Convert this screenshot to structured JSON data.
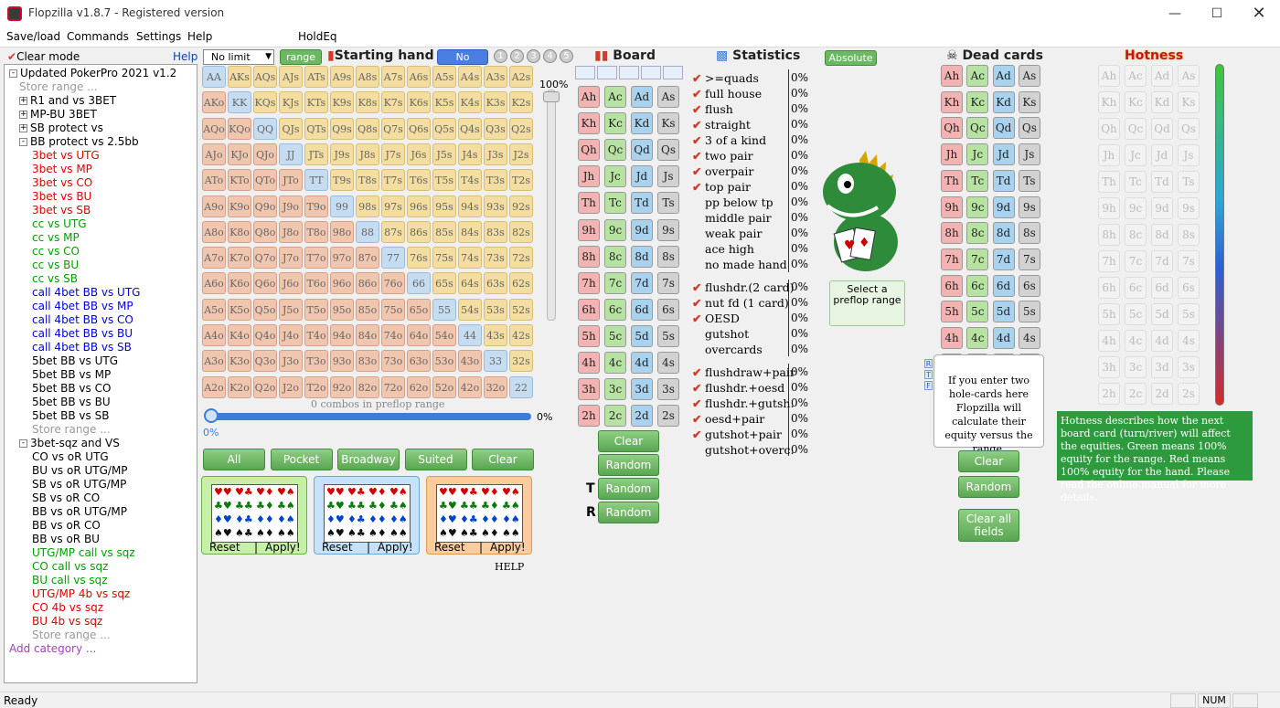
{
  "title": "Flopzilla v1.8.7 - Registered version",
  "menu": [
    "Save/load",
    "Commands",
    "Settings",
    "Help",
    "HoldEq"
  ],
  "left": {
    "clear_mode": "Clear mode",
    "help": "Help",
    "tree": [
      {
        "t": "Updated PokerPro 2021 v1.2",
        "lvl": 0,
        "pm": "-",
        "c": "#000"
      },
      {
        "t": "Store range ...",
        "lvl": 1,
        "c": "#999"
      },
      {
        "t": "R1 and vs 3BET",
        "lvl": 1,
        "pm": "+",
        "c": "#000"
      },
      {
        "t": "MP-BU 3BET",
        "lvl": 1,
        "pm": "+",
        "c": "#000"
      },
      {
        "t": "SB protect vs",
        "lvl": 1,
        "pm": "+",
        "c": "#000"
      },
      {
        "t": "BB protect vs 2.5bb",
        "lvl": 1,
        "pm": "-",
        "c": "#000"
      },
      {
        "t": "3bet vs UTG",
        "lvl": 2,
        "c": "#e00000"
      },
      {
        "t": "3bet vs MP",
        "lvl": 2,
        "c": "#e00000"
      },
      {
        "t": "3bet vs CO",
        "lvl": 2,
        "c": "#e00000"
      },
      {
        "t": "3bet vs BU",
        "lvl": 2,
        "c": "#e00000"
      },
      {
        "t": "3bet vs SB",
        "lvl": 2,
        "c": "#e00000"
      },
      {
        "t": "cc vs UTG",
        "lvl": 2,
        "c": "#00a000"
      },
      {
        "t": "cc vs MP",
        "lvl": 2,
        "c": "#00a000"
      },
      {
        "t": "cc vs CO",
        "lvl": 2,
        "c": "#00a000"
      },
      {
        "t": "cc vs BU",
        "lvl": 2,
        "c": "#00a000"
      },
      {
        "t": "cc vs SB",
        "lvl": 2,
        "c": "#00a000"
      },
      {
        "t": "call 4bet BB vs UTG",
        "lvl": 2,
        "c": "#0000e0"
      },
      {
        "t": "call 4bet BB vs MP",
        "lvl": 2,
        "c": "#0000e0"
      },
      {
        "t": "call 4bet BB vs CO",
        "lvl": 2,
        "c": "#0000e0"
      },
      {
        "t": "call 4bet BB vs BU",
        "lvl": 2,
        "c": "#0000e0"
      },
      {
        "t": "call 4bet BB vs SB",
        "lvl": 2,
        "c": "#0000e0"
      },
      {
        "t": "5bet BB vs UTG",
        "lvl": 2,
        "c": "#000"
      },
      {
        "t": "5bet BB vs MP",
        "lvl": 2,
        "c": "#000"
      },
      {
        "t": "5bet BB vs CO",
        "lvl": 2,
        "c": "#000"
      },
      {
        "t": "5bet BB vs BU",
        "lvl": 2,
        "c": "#000"
      },
      {
        "t": "5bet BB vs SB",
        "lvl": 2,
        "c": "#000"
      },
      {
        "t": "Store range ...",
        "lvl": 2,
        "c": "#999"
      },
      {
        "t": "3bet-sqz and VS",
        "lvl": 1,
        "pm": "-",
        "c": "#000"
      },
      {
        "t": "CO vs oR UTG",
        "lvl": 2,
        "c": "#000"
      },
      {
        "t": "BU vs oR UTG/MP",
        "lvl": 2,
        "c": "#000"
      },
      {
        "t": "SB vs oR UTG/MP",
        "lvl": 2,
        "c": "#000"
      },
      {
        "t": "SB vs oR CO",
        "lvl": 2,
        "c": "#000"
      },
      {
        "t": "BB vs oR UTG/MP",
        "lvl": 2,
        "c": "#000"
      },
      {
        "t": "BB vs oR CO",
        "lvl": 2,
        "c": "#000"
      },
      {
        "t": "BB vs oR BU",
        "lvl": 2,
        "c": "#000"
      },
      {
        "t": "UTG/MP call vs sqz",
        "lvl": 2,
        "c": "#00a000"
      },
      {
        "t": "CO call vs sqz",
        "lvl": 2,
        "c": "#00a000"
      },
      {
        "t": "BU call vs sqz",
        "lvl": 2,
        "c": "#00a000"
      },
      {
        "t": "UTG/MP 4b vs sqz",
        "lvl": 2,
        "c": "#e00000"
      },
      {
        "t": "CO 4b vs sqz",
        "lvl": 2,
        "c": "#e00000"
      },
      {
        "t": "BU 4b vs sqz",
        "lvl": 2,
        "c": "#e00000"
      },
      {
        "t": "Store range ...",
        "lvl": 2,
        "c": "#999"
      },
      {
        "t": "Add category ...",
        "lvl": 0,
        "c": "#a040c0"
      }
    ]
  },
  "range": {
    "limit": "No limit",
    "range_btn": "range",
    "starting_hand": "Starting hand",
    "no_weight": "No weight",
    "weights": [
      "1",
      "2",
      "3",
      "4",
      "5"
    ],
    "ranks": [
      "A",
      "K",
      "Q",
      "J",
      "T",
      "9",
      "8",
      "7",
      "6",
      "5",
      "4",
      "3",
      "2"
    ],
    "slider_top": "100%",
    "combos": "0 combos in preflop range",
    "bottom_slider": "0%",
    "bottom_left": "0%",
    "buttons": [
      "All",
      "Pocket",
      "Broadway",
      "Suited",
      "Clear"
    ],
    "reset": "Reset",
    "apply": "Apply!",
    "help": "HELP"
  },
  "board": {
    "header": "Board",
    "clear": "Clear",
    "random": "Random",
    "t": "T",
    "r": "R"
  },
  "stats": {
    "header": "Statistics",
    "absolute": "Absolute",
    "g1": [
      [
        "1",
        ">=quads",
        "0%"
      ],
      [
        "1",
        "full house",
        "0%"
      ],
      [
        "1",
        "flush",
        "0%"
      ],
      [
        "1",
        "straight",
        "0%"
      ],
      [
        "1",
        "3 of a kind",
        "0%"
      ],
      [
        "1",
        "two pair",
        "0%"
      ],
      [
        "1",
        "overpair",
        "0%"
      ],
      [
        "1",
        "top pair",
        "0%"
      ],
      [
        "0",
        "pp below tp",
        "0%"
      ],
      [
        "0",
        "middle pair",
        "0%"
      ],
      [
        "0",
        "weak pair",
        "0%"
      ],
      [
        "0",
        "ace high",
        "0%"
      ],
      [
        "0",
        "no made hand",
        "0%"
      ]
    ],
    "g2": [
      [
        "1",
        "flushdr.(2 card)",
        "0%"
      ],
      [
        "1",
        "nut fd (1 card)",
        "0%"
      ],
      [
        "1",
        "OESD",
        "0%"
      ],
      [
        "0",
        "gutshot",
        "0%"
      ],
      [
        "0",
        "overcards",
        "0%"
      ]
    ],
    "g3": [
      [
        "1",
        "flushdraw+pair",
        "0%"
      ],
      [
        "1",
        "flushdr.+oesd",
        "0%"
      ],
      [
        "1",
        "flushdr.+gutsh.",
        "0%"
      ],
      [
        "1",
        "oesd+pair",
        "0%"
      ],
      [
        "1",
        "gutshot+pair",
        "0%"
      ],
      [
        "0",
        "gutshot+overc.",
        "0%"
      ]
    ],
    "select_preflop": "Select a preflop range"
  },
  "dead": {
    "header": "Dead cards",
    "info": "If you enter two hole-cards here Flopzilla will calculate their equity versus the range.",
    "clear": "Clear",
    "random": "Random",
    "clear_all": "Clear all fields",
    "rtf": [
      "R",
      "T",
      "F"
    ]
  },
  "hot": {
    "header": "Hotness",
    "info": "Hotness describes how the next board card (turn/river) will affect the equities. Green means 100% equity for the range. Red means 100% equity for the hand. Please read the online manual for more details."
  },
  "status": {
    "ready": "Ready",
    "num": "NUM"
  },
  "suits": [
    "h",
    "c",
    "d",
    "s"
  ],
  "colors": {
    "green_btn": "#5aa552",
    "hotness_bg": "#2e9a3e",
    "title_red": "#c8102e"
  }
}
